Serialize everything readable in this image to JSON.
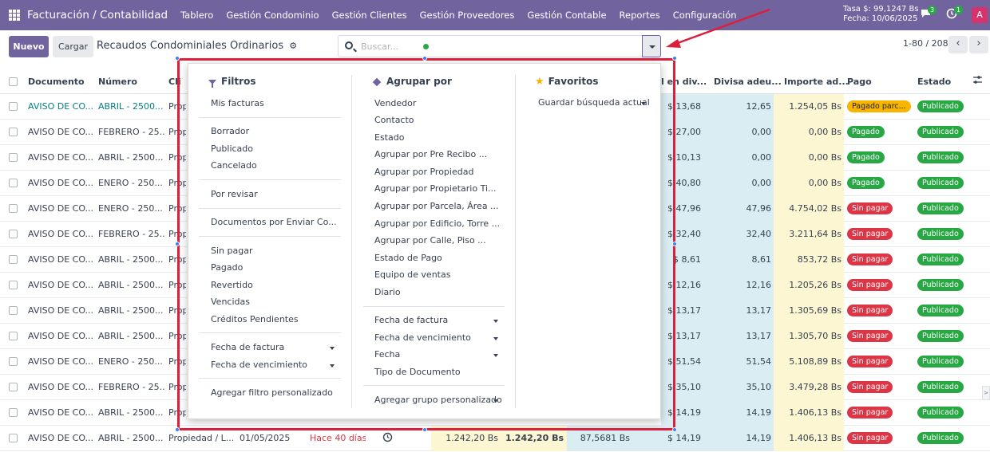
{
  "navbar": {
    "app_title": "Facturación / Contabilidad",
    "menu": [
      "Tablero",
      "Gestión Condominio",
      "Gestión Clientes",
      "Gestión Proveedores",
      "Gestión Contable",
      "Reportes",
      "Configuración"
    ],
    "rate_line1": "Tasa $: 99,1247 Bs",
    "rate_line2": "Fecha: 10/06/2025",
    "messages_count": "3",
    "activities_count": "1",
    "avatar_letter": "A"
  },
  "control": {
    "new_label": "Nuevo",
    "upload_label": "Cargar",
    "breadcrumb": "Recaudos Condominiales Ordinarios",
    "search_placeholder": "Buscar...",
    "pager": "1-80 / 208"
  },
  "table": {
    "headers": {
      "documento": "Documento",
      "numero": "Número",
      "cliente": "Cli",
      "total_divisa": "l en div...",
      "divisa_adeudada": "Divisa adeu...",
      "importe": "Importe ad...",
      "pago": "Pago",
      "estado": "Estado"
    },
    "rows": [
      {
        "doc": "AVISO DE CO...",
        "num": "ABRIL - 2500...",
        "cli": "Prop",
        "total": "$ 13,68",
        "adeu": "12,65",
        "imp": "1.254,05 Bs",
        "pago": "Pagado parc...",
        "pago_type": "orange",
        "estado": "Publicado",
        "link": true
      },
      {
        "doc": "AVISO DE CO...",
        "num": "FEBRERO - 25...",
        "cli": "Prop",
        "total": "$ 27,00",
        "adeu": "0,00",
        "imp": "0,00 Bs",
        "pago": "Pagado",
        "pago_type": "green",
        "estado": "Publicado"
      },
      {
        "doc": "AVISO DE CO...",
        "num": "ABRIL - 2500...",
        "cli": "Prop",
        "total": "$ 10,13",
        "adeu": "0,00",
        "imp": "0,00 Bs",
        "pago": "Pagado",
        "pago_type": "green",
        "estado": "Publicado"
      },
      {
        "doc": "AVISO DE CO...",
        "num": "ENERO - 250...",
        "cli": "Prop",
        "total": "$ 40,80",
        "adeu": "0,00",
        "imp": "0,00 Bs",
        "pago": "Pagado",
        "pago_type": "green",
        "estado": "Publicado"
      },
      {
        "doc": "AVISO DE CO...",
        "num": "ENERO - 250...",
        "cli": "Prop",
        "total": "$ 47,96",
        "adeu": "47,96",
        "imp": "4.754,02 Bs",
        "pago": "Sin pagar",
        "pago_type": "red",
        "estado": "Publicado"
      },
      {
        "doc": "AVISO DE CO...",
        "num": "FEBRERO - 25...",
        "cli": "Prop",
        "total": "$ 32,40",
        "adeu": "32,40",
        "imp": "3.211,64 Bs",
        "pago": "Sin pagar",
        "pago_type": "red",
        "estado": "Publicado"
      },
      {
        "doc": "AVISO DE CO...",
        "num": "ABRIL - 2500...",
        "cli": "Prop",
        "total": "$ 8,61",
        "adeu": "8,61",
        "imp": "853,72 Bs",
        "pago": "Sin pagar",
        "pago_type": "red",
        "estado": "Publicado"
      },
      {
        "doc": "AVISO DE CO...",
        "num": "ABRIL - 2500...",
        "cli": "Prop",
        "total": "$ 12,16",
        "adeu": "12,16",
        "imp": "1.205,26 Bs",
        "pago": "Sin pagar",
        "pago_type": "red",
        "estado": "Publicado"
      },
      {
        "doc": "AVISO DE CO...",
        "num": "ABRIL - 2500...",
        "cli": "Prop",
        "total": "$ 13,17",
        "adeu": "13,17",
        "imp": "1.305,69 Bs",
        "pago": "Sin pagar",
        "pago_type": "red",
        "estado": "Publicado"
      },
      {
        "doc": "AVISO DE CO...",
        "num": "ABRIL - 2500...",
        "cli": "Prop",
        "total": "$ 13,17",
        "adeu": "13,17",
        "imp": "1.305,70 Bs",
        "pago": "Sin pagar",
        "pago_type": "red",
        "estado": "Publicado"
      },
      {
        "doc": "AVISO DE CO...",
        "num": "ENERO - 250...",
        "cli": "Prop",
        "total": "$ 51,54",
        "adeu": "51,54",
        "imp": "5.108,89 Bs",
        "pago": "Sin pagar",
        "pago_type": "red",
        "estado": "Publicado"
      },
      {
        "doc": "AVISO DE CO...",
        "num": "FEBRERO - 25...",
        "cli": "Prop",
        "total": "$ 35,10",
        "adeu": "35,10",
        "imp": "3.479,28 Bs",
        "pago": "Sin pagar",
        "pago_type": "red",
        "estado": "Publicado"
      },
      {
        "doc": "AVISO DE CO...",
        "num": "ABRIL - 2500...",
        "cli": "Prop",
        "total": "$ 14,19",
        "adeu": "14,19",
        "imp": "1.406,13 Bs",
        "pago": "Sin pagar",
        "pago_type": "red",
        "estado": "Publicado"
      },
      {
        "doc": "AVISO DE CO...",
        "num": "ABRIL - 2500...",
        "cli": "Propiedad / L...",
        "date": "01/05/2025",
        "due": "Hace 40 días",
        "amt1": "1.242,20 Bs",
        "amt2": "1.242,20 Bs",
        "usd": "87,5681 Bs",
        "total": "$ 14,19",
        "adeu": "14,19",
        "imp": "1.406,13 Bs",
        "pago": "Sin pagar",
        "pago_type": "red",
        "estado": "Publicado",
        "full": true
      }
    ]
  },
  "dropdown": {
    "filters": {
      "title": "Filtros",
      "items": [
        "Mis facturas",
        "Borrador",
        "Publicado",
        "Cancelado",
        "Por revisar",
        "Documentos por Enviar Co...",
        "Sin pagar",
        "Pagado",
        "Revertido",
        "Vencidas",
        "Créditos Pendientes",
        "Fecha de factura",
        "Fecha de vencimiento",
        "Agregar filtro personalizado"
      ]
    },
    "groupby": {
      "title": "Agrupar por",
      "items": [
        "Vendedor",
        "Contacto",
        "Estado",
        "Agrupar por Pre Recibo ...",
        "Agrupar por Propiedad",
        "Agrupar por Propietario Ti...",
        "Agrupar por Parcela, Área ...",
        "Agrupar por Edificio, Torre ...",
        "Agrupar por Calle, Piso ...",
        "Estado de Pago",
        "Equipo de ventas",
        "Diario",
        "Fecha de factura",
        "Fecha de vencimiento",
        "Fecha",
        "Tipo de Documento",
        "Agregar grupo personalizado"
      ]
    },
    "favorites": {
      "title": "Favoritos",
      "save_label": "Guardar búsqueda actual"
    }
  },
  "colors": {
    "brand": "#71639e",
    "annotation": "#dc1f3a"
  }
}
